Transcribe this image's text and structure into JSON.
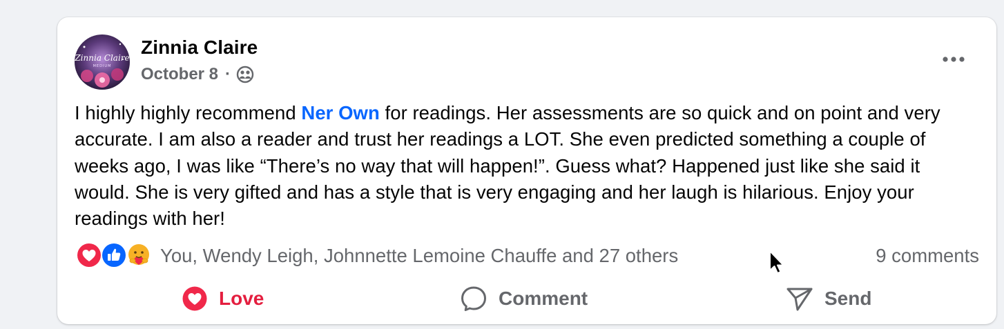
{
  "post": {
    "author": "Zinnia Claire",
    "avatar_text": "Zinnia Claire",
    "avatar_subtext": "MEDIUM",
    "date": "October 8",
    "separator": "·",
    "audience_icon": "friends-icon",
    "text": {
      "part1": "I highly highly recommend ",
      "mention": "Ner Own",
      "part2": " for readings. Her assessments are so quick and on point and very accurate. I am also a reader and trust her readings a LOT.  She even predicted something a couple of weeks ago, I was like “There’s no way that will happen!”.  Guess what?  Happened just like she said it would.  She is very gifted and has a style that is very engaging and her laugh is hilarious.  Enjoy your readings with her!"
    },
    "reactions": {
      "icons": [
        "love-icon",
        "like-icon",
        "care-icon"
      ],
      "summary": "You, Wendy Leigh, Johnnette Lemoine Chauffe and 27 others",
      "comments": "9 comments"
    },
    "actions": {
      "love": "Love",
      "comment": "Comment",
      "send": "Send"
    }
  },
  "colors": {
    "background": "#f0f2f5",
    "card": "#ffffff",
    "text": "#050505",
    "secondary_text": "#65676b",
    "mention": "#0866ff",
    "love": "#e41e3f",
    "like": "#0866ff",
    "care": "#f7b125"
  }
}
